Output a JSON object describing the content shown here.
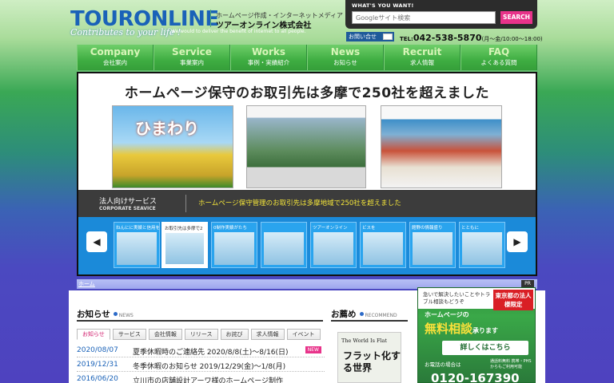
{
  "header": {
    "logo_text": "TOURONLINE",
    "logo_sub": "Contributes to your life !",
    "tagline_top": "ホームページ作成・インターネットメディア",
    "company_name": "ツアーオンライン株式会社",
    "tagline_en": "We would to deliver the benefit of internet to all people.",
    "search_heading": "WHAT'S YOU WANT!",
    "search_placeholder": "Googleサイト検索",
    "search_button": "SEARCH",
    "contact_label": "お問い合せ",
    "tel_prefix": "TEL:",
    "tel_number": "042-538-5870",
    "tel_hours": "(月〜金/10:00〜18:00)"
  },
  "nav": [
    {
      "en": "Company",
      "jp": "会社案内"
    },
    {
      "en": "Service",
      "jp": "事業案内"
    },
    {
      "en": "Works",
      "jp": "事例・実績紹介"
    },
    {
      "en": "News",
      "jp": "お知らせ"
    },
    {
      "en": "Recruit",
      "jp": "求人情報"
    },
    {
      "en": "FAQ",
      "jp": "よくある質問"
    }
  ],
  "hero": {
    "headline": "ホームページ保守のお取引先は多摩で250社を超えました",
    "category": "法人向けサービス",
    "category_en": "CORPORATE SEAVICE",
    "caption": "ホームページ保守管理のお取引先は多摩地域で250社を超えました",
    "slide1_title": "ひまわり",
    "arrow_left": "◀",
    "arrow_right": "▶",
    "thumbnails": [
      {
        "label": "ねんにに実績と信用を"
      },
      {
        "label": "お取引先は多摩で2"
      },
      {
        "label": "0制作実績がたち"
      },
      {
        "label": ""
      },
      {
        "label": "ツアーオンライン"
      },
      {
        "label": "ビスを"
      },
      {
        "label": "館野の情報盛り"
      },
      {
        "label": "とともに"
      }
    ]
  },
  "breadcrumb": {
    "home": "ホーム",
    "pr": "PR"
  },
  "news": {
    "title": "お知らせ",
    "title_en": "NEWS",
    "tabs": [
      "お知らせ",
      "サービス",
      "会社情報",
      "リリース",
      "お詫び",
      "求人情報",
      "イベント"
    ],
    "items": [
      {
        "date": "2020/08/07",
        "text": "夏季休暇時のご連絡先 2020/8/8(土)〜8/16(日)",
        "badge": "NEW"
      },
      {
        "date": "2019/12/31",
        "text": "冬季休暇のお知らせ 2019/12/29(金)〜1/8(月)",
        "badge": ""
      },
      {
        "date": "2016/06/20",
        "text": "立川市の店舗設計アーワ様のホームページ制作",
        "badge": ""
      }
    ]
  },
  "recommend": {
    "title": "お薦め",
    "title_en": "RECOMMEND",
    "book_en": "The World Is Flat",
    "book_jp": "フラット化する世界"
  },
  "ad": {
    "question": "急いで解決したいことやトラブル相談もどうぞ",
    "tokyo": "東京都の法人様限定",
    "hp": "ホームページの",
    "free": "無料相談",
    "free_suffix": "承ります",
    "detail": "詳しくはこちら",
    "call": "お電話の場合は",
    "hours": "通話料無料 携帯・PHSからもご利用可能",
    "phone": "0120-167390"
  }
}
